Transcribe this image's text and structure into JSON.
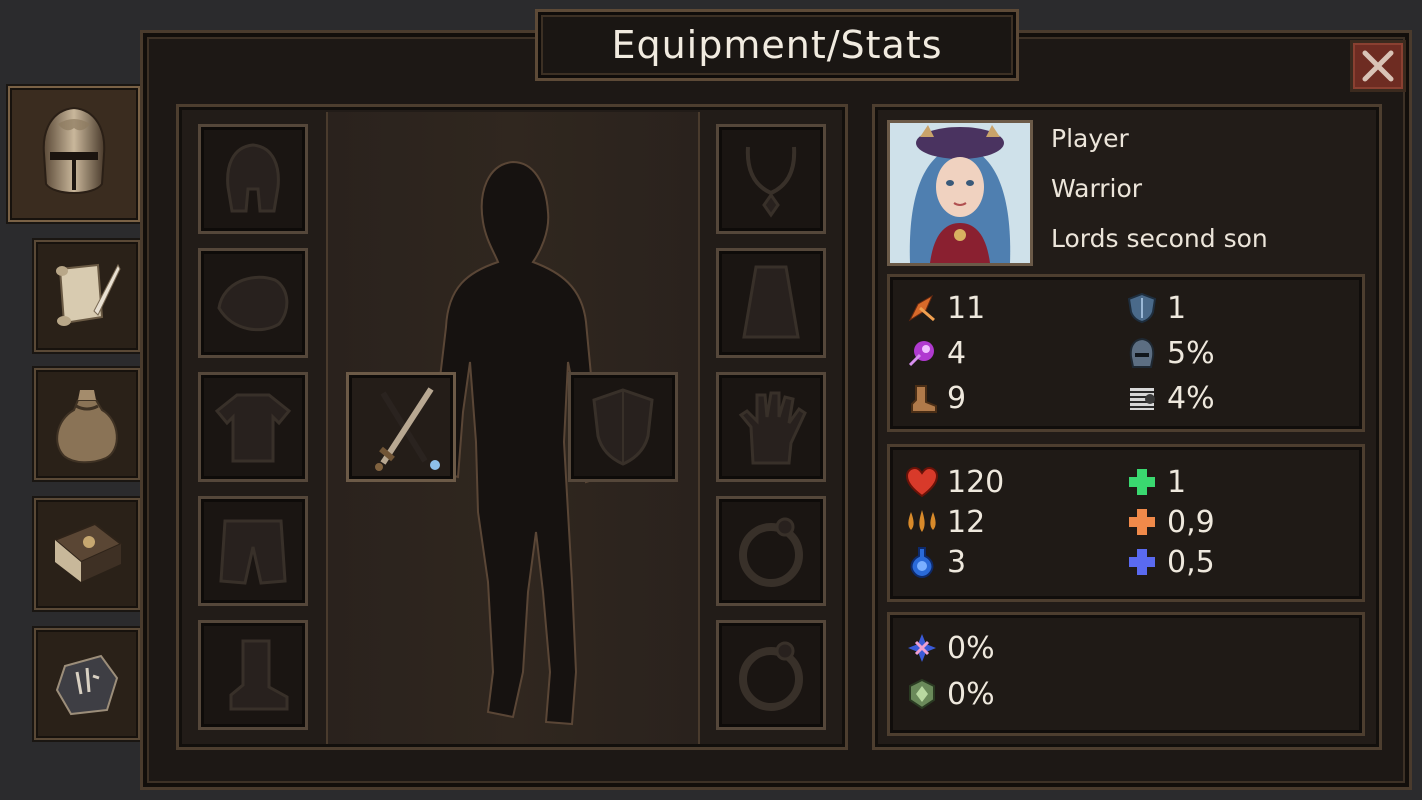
{
  "title": "Equipment/Stats",
  "side_tabs": [
    {
      "id": "equipment",
      "icon": "helmet-icon",
      "active": true
    },
    {
      "id": "quests",
      "icon": "scroll-quill-icon",
      "active": false
    },
    {
      "id": "inventory",
      "icon": "bag-icon",
      "active": false
    },
    {
      "id": "spellbook",
      "icon": "book-icon",
      "active": false
    },
    {
      "id": "runes",
      "icon": "rune-stone-icon",
      "active": false
    }
  ],
  "character": {
    "name": "Player",
    "class": "Warrior",
    "background": "Lords second son"
  },
  "equipment_slots": {
    "left": [
      "helmet",
      "shoulders",
      "chest",
      "legs",
      "boots"
    ],
    "right": [
      "amulet",
      "cloak",
      "gloves",
      "ring-1",
      "ring-2"
    ],
    "main_hand": "sword (equipped)",
    "off_hand": "shield (empty)"
  },
  "stats_primary": [
    {
      "icon": "strength-icon",
      "value": "11"
    },
    {
      "icon": "armor-shield-icon",
      "value": "1"
    },
    {
      "icon": "magic-icon",
      "value": "4"
    },
    {
      "icon": "helmet-defense-icon",
      "value": "5%"
    },
    {
      "icon": "agility-boot-icon",
      "value": "9"
    },
    {
      "icon": "evasion-icon",
      "value": "4%"
    }
  ],
  "stats_vitals": [
    {
      "icon": "heart-icon",
      "value": "120"
    },
    {
      "icon": "green-cross-icon",
      "value": "1"
    },
    {
      "icon": "stamina-drops-icon",
      "value": "12"
    },
    {
      "icon": "orange-cross-icon",
      "value": "0,9"
    },
    {
      "icon": "mana-flask-icon",
      "value": "3"
    },
    {
      "icon": "blue-cross-icon",
      "value": "0,5"
    }
  ],
  "stats_resist": [
    {
      "icon": "crit-icon",
      "value": "0%"
    },
    {
      "icon": "poison-resist-icon",
      "value": "0%"
    }
  ],
  "colors": {
    "frame_border": "#4a3b2d",
    "panel_bg": "#221c18",
    "text": "#ece5da",
    "close_button": "#6e2c22"
  }
}
